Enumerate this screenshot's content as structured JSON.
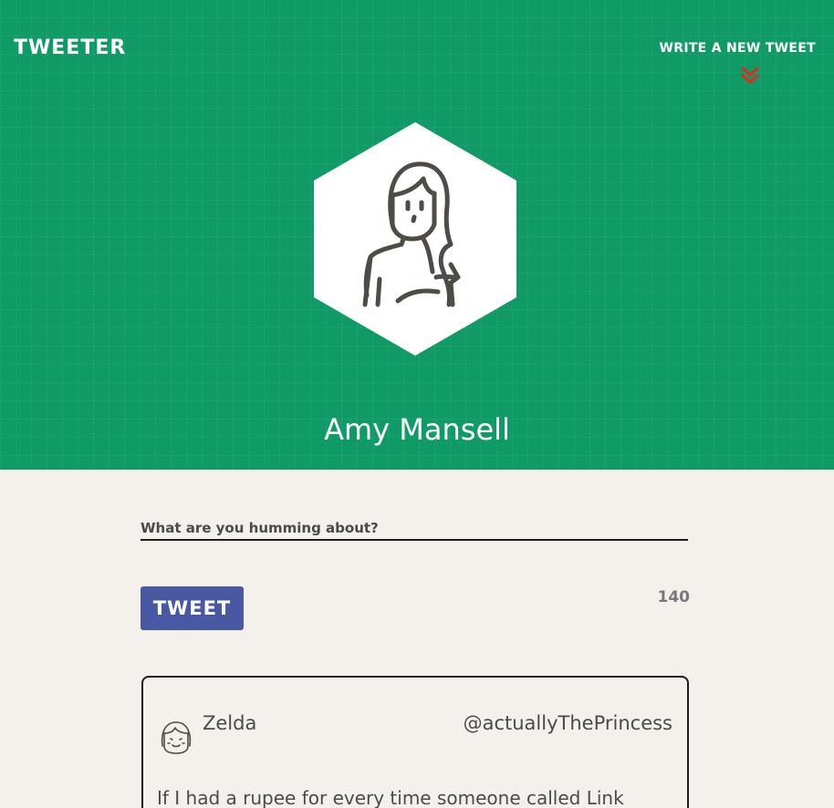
{
  "header": {
    "brand": "TWEETER",
    "write_link": "WRITE A NEW TWEET",
    "user_name": "Amy Mansell",
    "colors": {
      "background": "#0f9a66",
      "chevron": "#e8251f"
    }
  },
  "composer": {
    "placeholder": "What are you humming about?",
    "value": "",
    "tweet_button_label": "TWEET",
    "char_count": "140",
    "colors": {
      "button": "#4858a3"
    }
  },
  "tweets": [
    {
      "name": "Zelda",
      "handle": "@actuallyThePrincess",
      "text": "If I had a rupee for every time someone called Link"
    }
  ],
  "icons": {
    "avatar": "woman-avatar-icon",
    "chevron": "double-chevron-down-icon",
    "tweet_avatar": "girl-avatar-icon"
  }
}
